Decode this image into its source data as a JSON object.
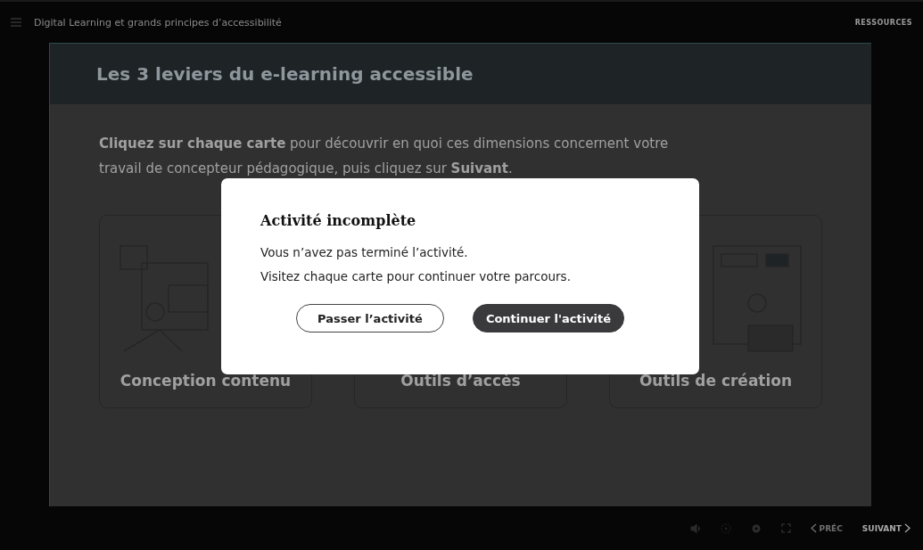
{
  "top_bar": {
    "title": "Digital Learning et grands principes d’accessibilité",
    "resources": "RESSOURCES"
  },
  "slide": {
    "title": "Les 3 leviers du e-learning accessible",
    "instructions": "**Cliquez sur chaque carte** pour découvrir en quoi ces dimensions concernent votre travail de concepteur pédagogique, puis cliquez sur **Suivant**.",
    "cards": [
      {
        "title": "Conception contenu"
      },
      {
        "title": "Outils d’accès"
      },
      {
        "title": "Outils de création"
      }
    ]
  },
  "dialog": {
    "title": "Activité incomplète",
    "lines": [
      "Vous n’avez pas terminé l’activité.",
      "Visitez chaque carte pour continuer votre parcours."
    ],
    "buttons": [
      {
        "label": "Passer l’activité",
        "kind": "outline"
      },
      {
        "label": "Continuer l'activité",
        "kind": "filled"
      }
    ]
  },
  "bottom_bar": {
    "prev": {
      "label": "PRÉC",
      "disabled": true
    },
    "next": {
      "label": "SUIVANT",
      "disabled": false
    }
  }
}
